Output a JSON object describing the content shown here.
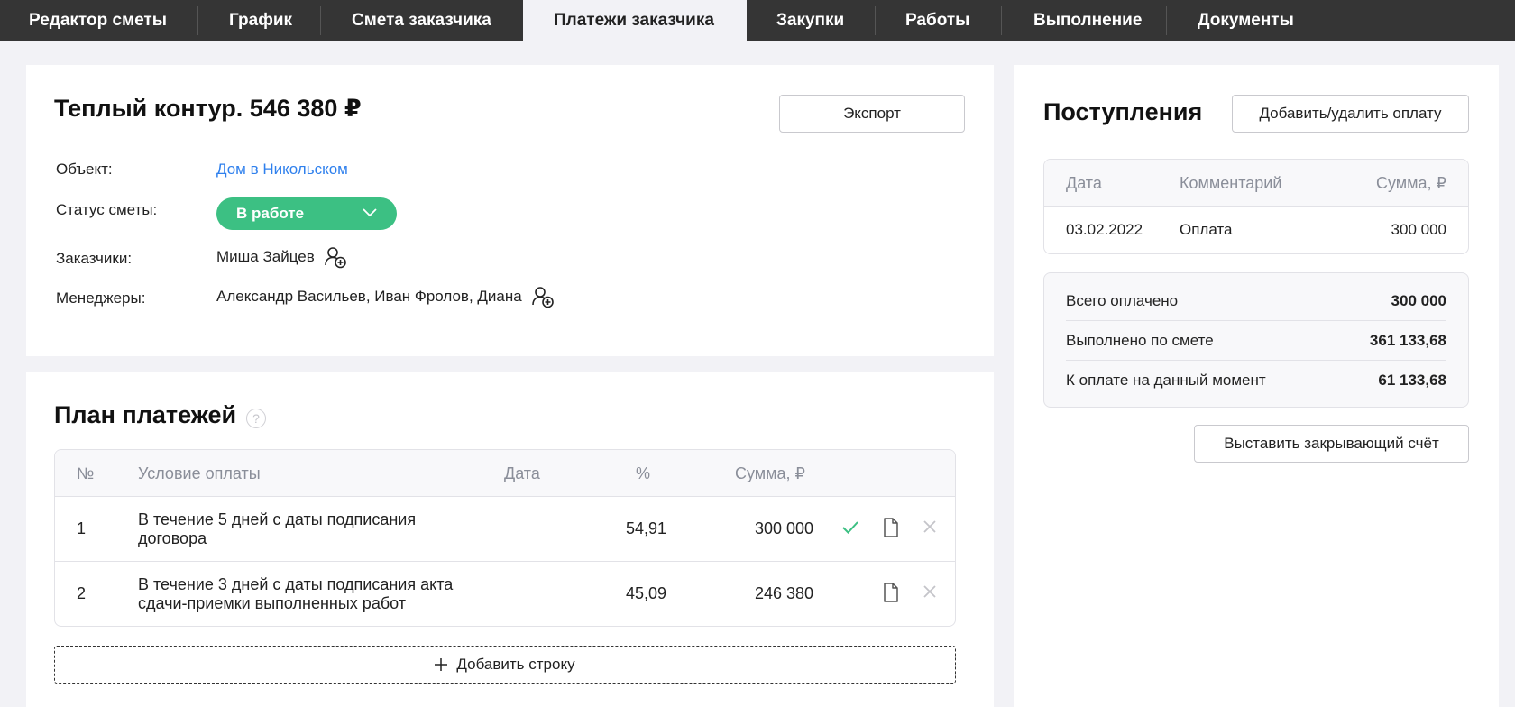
{
  "nav": {
    "tabs": [
      {
        "label": "Редактор сметы"
      },
      {
        "label": "График"
      },
      {
        "label": "Смета заказчика"
      },
      {
        "label": "Платежи заказчика"
      },
      {
        "label": "Закупки"
      },
      {
        "label": "Работы"
      },
      {
        "label": "Выполнение"
      },
      {
        "label": "Документы"
      }
    ]
  },
  "estimate": {
    "title": "Теплый контур. 546 380 ₽",
    "export_label": "Экспорт",
    "object_label": "Объект:",
    "object_value": "Дом в Никольском",
    "status_label": "Статус сметы:",
    "status_value": "В работе",
    "customers_label": "Заказчики:",
    "customers_value": "Миша Зайцев",
    "managers_label": "Менеджеры:",
    "managers_value": "Александр Васильев, Иван Фролов, Диана"
  },
  "plan": {
    "title": "План платежей",
    "help": "?",
    "columns": {
      "num": "№",
      "condition": "Условие оплаты",
      "date": "Дата",
      "percent": "%",
      "sum": "Сумма, ₽"
    },
    "rows": [
      {
        "num": "1",
        "condition_line1": "В течение 5 дней с даты подписания",
        "condition_line2": "договора",
        "date": "",
        "percent": "54,91",
        "sum": "300 000",
        "paid": true
      },
      {
        "num": "2",
        "condition_line1": "В течение 3 дней с даты подписания акта",
        "condition_line2": "сдачи-приемки выполненных работ",
        "date": "",
        "percent": "45,09",
        "sum": "246 380",
        "paid": false
      }
    ],
    "add_row_label": "Добавить строку"
  },
  "receipts": {
    "title": "Поступления",
    "add_remove_label": "Добавить/удалить оплату",
    "columns": {
      "date": "Дата",
      "comment": "Комментарий",
      "sum": "Сумма, ₽"
    },
    "rows": [
      {
        "date": "03.02.2022",
        "comment": "Оплата",
        "sum": "300 000"
      }
    ],
    "summary": [
      {
        "label": "Всего оплачено",
        "value": "300 000"
      },
      {
        "label": "Выполнено по смете",
        "value": "361 133,68"
      },
      {
        "label": "К оплате на данный момент",
        "value": "61 133,68"
      }
    ],
    "closing_invoice_label": "Выставить закрывающий счёт"
  },
  "colors": {
    "accent_green": "#3cc083",
    "link_blue": "#2f80ed",
    "nav_bg": "#353535"
  }
}
